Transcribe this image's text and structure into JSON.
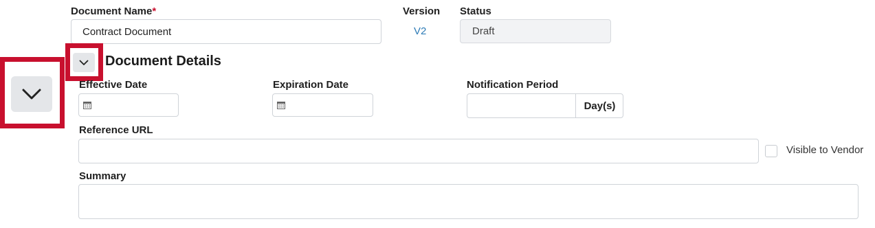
{
  "document_name": {
    "label": "Document Name",
    "required_marker": "*",
    "value": "Contract Document"
  },
  "version": {
    "label": "Version",
    "value": "V2"
  },
  "status": {
    "label": "Status",
    "value": "Draft"
  },
  "section": {
    "title": "Document Details",
    "toggle_icon": "chevron-down-icon",
    "expanded": true
  },
  "effective_date": {
    "label": "Effective Date",
    "value": "",
    "icon": "calendar-icon"
  },
  "expiration_date": {
    "label": "Expiration Date",
    "value": "",
    "icon": "calendar-icon"
  },
  "notification_period": {
    "label": "Notification Period",
    "value": "",
    "unit": "Day(s)"
  },
  "reference_url": {
    "label": "Reference URL",
    "value": ""
  },
  "visible_to_vendor": {
    "label": "Visible to Vendor",
    "checked": false
  },
  "summary": {
    "label": "Summary",
    "value": ""
  },
  "colors": {
    "highlight": "#c8102e",
    "link": "#2d7bb6",
    "required": "#c8102e"
  }
}
